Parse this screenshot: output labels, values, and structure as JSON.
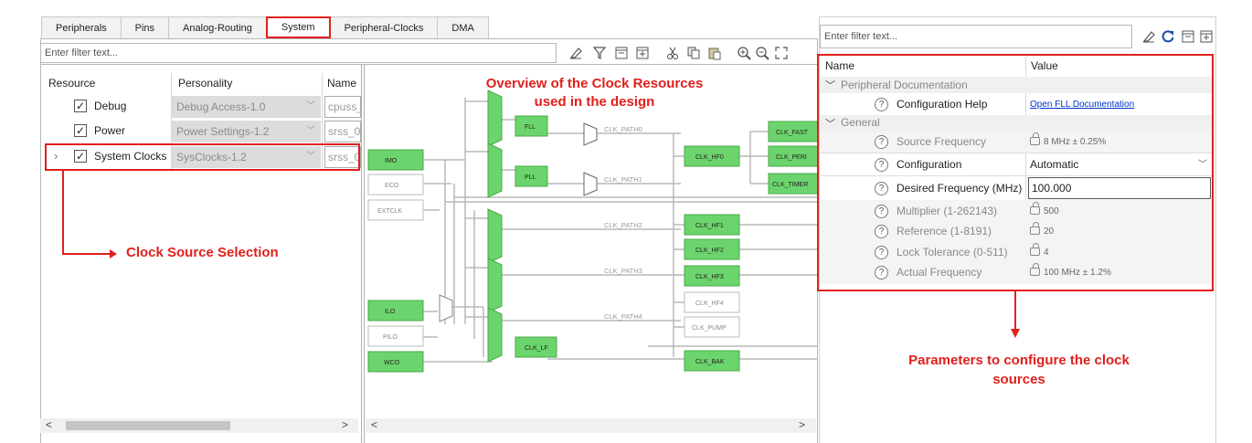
{
  "tabs": [
    {
      "label": "Peripherals"
    },
    {
      "label": "Pins"
    },
    {
      "label": "Analog-Routing"
    },
    {
      "label": "System",
      "active": true
    },
    {
      "label": "Peripheral-Clocks"
    },
    {
      "label": "DMA"
    }
  ],
  "left_filter": {
    "placeholder": "Enter filter text..."
  },
  "resource_table": {
    "headers": {
      "resource": "Resource",
      "personality": "Personality",
      "name": "Name"
    },
    "rows": [
      {
        "resource": "Debug",
        "personality": "Debug Access-1.0",
        "name": "cpuss_",
        "checked": true
      },
      {
        "resource": "Power",
        "personality": "Power Settings-1.2",
        "name": "srss_0",
        "checked": true
      },
      {
        "resource": "System Clocks",
        "personality": "SysClocks-1.2",
        "name": "srss_0",
        "checked": true,
        "expandable": true
      }
    ]
  },
  "diagram": {
    "sources": [
      "IMO",
      "ECO",
      "EXTCLK",
      "ILO",
      "PILO",
      "WCO"
    ],
    "path_muxes": [
      "PATH_MUX0",
      "PATH_MUX1",
      "PATH_MUX2",
      "PATH_MUX3",
      "PATH_MUX4"
    ],
    "fll": "FLL",
    "pll": "PLL",
    "paths": [
      "CLK_PATH0",
      "CLK_PATH1",
      "CLK_PATH2",
      "CLK_PATH3",
      "CLK_PATH4"
    ],
    "hf": [
      "CLK_HF0",
      "CLK_HF1",
      "CLK_HF2",
      "CLK_HF3",
      "CLK_HF4"
    ],
    "clk_pump": "CLK_PUMP",
    "clk_lf": "CLK_LF",
    "clk_bak": "CLK_BAK",
    "right_outputs": [
      "CLK_FAST",
      "CLK_PERI",
      "CLK_TIMER"
    ]
  },
  "annotations": {
    "overview": "Overview of the Clock Resources\nused in the design",
    "clock_source": "Clock Source Selection",
    "parameters": "Parameters to configure the clock\nsources"
  },
  "right_filter": {
    "placeholder": "Enter filter text..."
  },
  "param_grid": {
    "headers": {
      "name": "Name",
      "value": "Value"
    },
    "groups": [
      {
        "label": "Peripheral Documentation"
      },
      {
        "label": "General"
      }
    ],
    "rows": [
      {
        "name": "Configuration Help",
        "value": "Open FLL Documentation",
        "kind": "link"
      },
      {
        "name": "Source Frequency",
        "value": "8 MHz ± 0.25%",
        "kind": "locked"
      },
      {
        "name": "Configuration",
        "value": "Automatic",
        "kind": "select"
      },
      {
        "name": "Desired Frequency (MHz)",
        "value": "100.000",
        "kind": "input"
      },
      {
        "name": "Multiplier (1-262143)",
        "value": "500",
        "kind": "locked"
      },
      {
        "name": "Reference (1-8191)",
        "value": "20",
        "kind": "locked"
      },
      {
        "name": "Lock Tolerance (0-511)",
        "value": "4",
        "kind": "locked"
      },
      {
        "name": "Actual Frequency",
        "value": "100 MHz ± 1.2%",
        "kind": "locked"
      }
    ]
  },
  "icons": [
    "eraser-icon",
    "filter-icon",
    "collapse-all-icon",
    "expand-all-icon",
    "cut-icon",
    "copy-icon",
    "paste-icon",
    "zoom-in-icon",
    "zoom-out-icon",
    "fit-icon",
    "refresh-icon"
  ],
  "colors": {
    "accent_red": "#e0201c",
    "block_green": "#6cd46c",
    "link_blue": "#0033cc"
  }
}
